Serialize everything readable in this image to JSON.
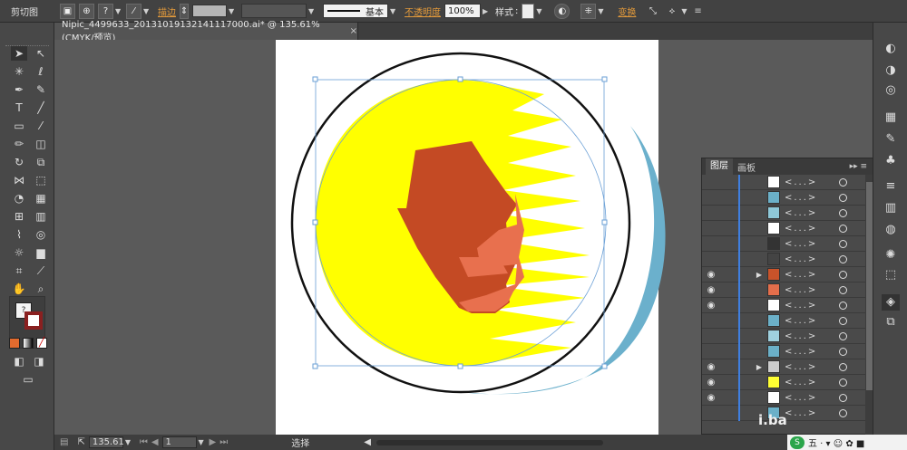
{
  "app": {
    "tool_name": "剪切图"
  },
  "control_bar": {
    "stroke_label": "描边",
    "stroke_style": "基本",
    "opacity_label": "不透明度",
    "opacity_value": "100%",
    "style_label": "样式",
    "transform_label": "变换"
  },
  "document": {
    "tab_title": "Nipic_4499633_20131019132141117000.ai* @ 135.61% (CMYK/预览)",
    "close": "×"
  },
  "layers_panel": {
    "tabs": [
      "图层",
      "画板"
    ],
    "rows": [
      {
        "eye": false,
        "arrow": false,
        "thumb_color": "#ffffff",
        "name": "<...>"
      },
      {
        "eye": false,
        "arrow": false,
        "thumb_color": "#6bb0c8",
        "name": "<...>"
      },
      {
        "eye": false,
        "arrow": false,
        "thumb_color": "#8ec8d8",
        "name": "<...>"
      },
      {
        "eye": false,
        "arrow": false,
        "thumb_color": "#ffffff",
        "name": "<...>"
      },
      {
        "eye": false,
        "arrow": false,
        "thumb_color": "#333333",
        "name": "<...>"
      },
      {
        "eye": false,
        "arrow": false,
        "thumb_color": "#444444",
        "name": "<...>"
      },
      {
        "eye": true,
        "arrow": true,
        "thumb_color": "#c9532a",
        "name": "<...>"
      },
      {
        "eye": true,
        "arrow": false,
        "thumb_color": "#e46e4b",
        "name": "<...>"
      },
      {
        "eye": true,
        "arrow": false,
        "thumb_color": "#ffffff",
        "name": "<...>"
      },
      {
        "eye": false,
        "arrow": false,
        "thumb_color": "#6bb0c8",
        "name": "<...>"
      },
      {
        "eye": false,
        "arrow": false,
        "thumb_color": "#9fd0de",
        "name": "<...>"
      },
      {
        "eye": false,
        "arrow": false,
        "thumb_color": "#6bb0c8",
        "name": "<...>"
      },
      {
        "eye": true,
        "arrow": true,
        "thumb_color": "#cccccc",
        "name": "<...>"
      },
      {
        "eye": true,
        "arrow": false,
        "thumb_color": "#ffff33",
        "name": "<...>"
      },
      {
        "eye": true,
        "arrow": false,
        "thumb_color": "#ffffff",
        "name": "<...>"
      },
      {
        "eye": false,
        "arrow": false,
        "thumb_color": "#6bb0c8",
        "name": "<...>"
      }
    ]
  },
  "status_bar": {
    "zoom": "135.61",
    "artboard_number": "1",
    "mode": "选择"
  },
  "watermark": {
    "logo": "S",
    "text": "五 · ▾ ☺ ✿ ■",
    "baidu": "i.ba"
  },
  "colors": {
    "yellow": "#ffff00",
    "face_dark": "#c44a24",
    "face_light": "#e8704e",
    "blue_shadow": "#6bb0cc",
    "selection": "#6a9fd6"
  }
}
